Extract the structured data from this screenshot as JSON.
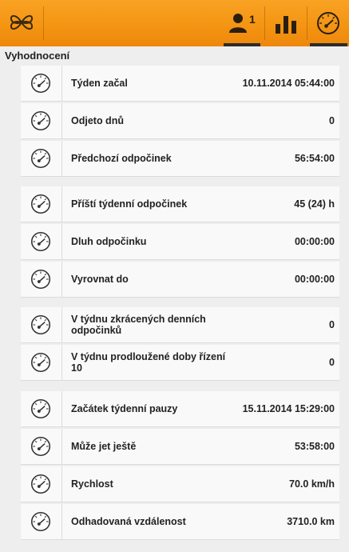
{
  "colors": {
    "header_gradient_top": "#f9a224",
    "header_gradient_bottom": "#ee870b",
    "background": "#eeeeee",
    "row_background": "#f9f9f9"
  },
  "header": {
    "logo_icon": "propeller-logo-icon",
    "tabs": [
      {
        "icon": "driver-icon",
        "badge": "1"
      },
      {
        "icon": "bar-chart-icon"
      },
      {
        "icon": "gauge-icon",
        "selected": true
      }
    ]
  },
  "section_title": "Vyhodnocení",
  "groups": [
    [
      {
        "icon": "gauge-icon",
        "label": "Týden začal",
        "value": "10.11.2014 05:44:00"
      },
      {
        "icon": "gauge-icon",
        "label": "Odjeto dnů",
        "value": "0"
      },
      {
        "icon": "gauge-icon",
        "label": "Předchozí odpočinek",
        "value": "56:54:00"
      }
    ],
    [
      {
        "icon": "gauge-icon",
        "label": "Příští týdenní odpočinek",
        "value": "45 (24) h"
      },
      {
        "icon": "gauge-icon",
        "label": "Dluh odpočinku",
        "value": "00:00:00"
      },
      {
        "icon": "gauge-icon",
        "label": "Vyrovnat do",
        "value": "00:00:00"
      }
    ],
    [
      {
        "icon": "gauge-icon",
        "label": "V týdnu zkrácených denních odpočinků",
        "value": "0"
      },
      {
        "icon": "gauge-icon",
        "label": "V týdnu prodloužené doby řízení 10",
        "value": "0"
      }
    ],
    [
      {
        "icon": "gauge-icon",
        "label": "Začátek týdenní pauzy",
        "value": "15.11.2014 15:29:00"
      },
      {
        "icon": "gauge-icon",
        "label": "Může jet ještě",
        "value": "53:58:00"
      },
      {
        "icon": "gauge-icon",
        "label": "Rychlost",
        "value": "70.0 km/h"
      },
      {
        "icon": "gauge-icon",
        "label": "Odhadovaná vzdálenost",
        "value": "3710.0 km"
      }
    ]
  ]
}
